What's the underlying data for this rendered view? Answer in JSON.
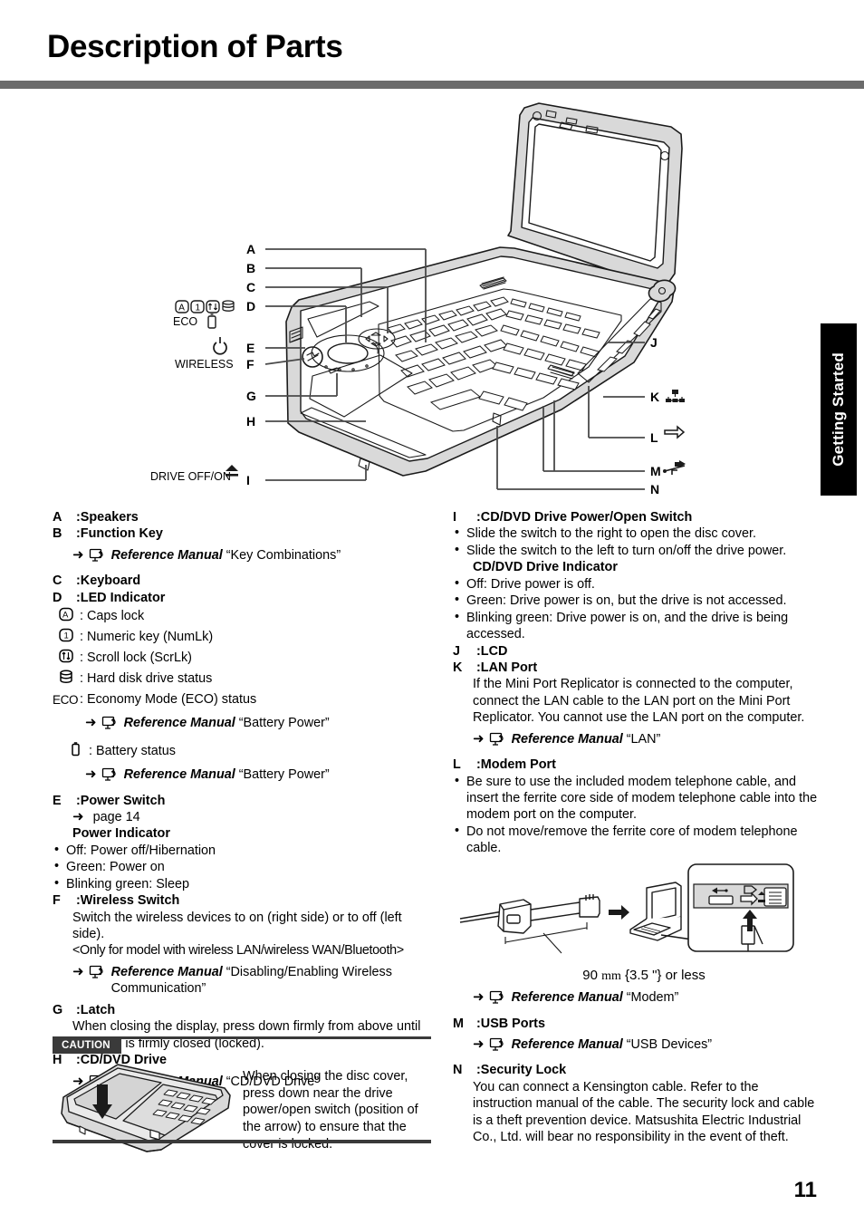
{
  "page": {
    "title": "Description of Parts",
    "number": "11",
    "side_tab": "Getting Started"
  },
  "figure": {
    "callouts_left": [
      "A",
      "B",
      "C",
      "D",
      "E",
      "F",
      "G",
      "H",
      "I"
    ],
    "callouts_right": [
      "J",
      "K",
      "L",
      "M",
      "N"
    ],
    "annotations": {
      "eco": "ECO",
      "wireless": "WIRELESS",
      "drive_off_on": "DRIVE OFF/ON"
    }
  },
  "left_column": {
    "A": {
      "letter": "A",
      "title": "Speakers"
    },
    "B": {
      "letter": "B",
      "title": "Function Key",
      "ref": {
        "manual": "Reference Manual",
        "topic": "“Key Combinations”"
      }
    },
    "C": {
      "letter": "C",
      "title": "Keyboard"
    },
    "D": {
      "letter": "D",
      "title": "LED Indicator",
      "items": [
        {
          "icon": "caps-lock-icon",
          "text": ": Caps lock"
        },
        {
          "icon": "numlock-icon",
          "text": ": Numeric key (NumLk)"
        },
        {
          "icon": "scroll-lock-icon",
          "text": ": Scroll lock (ScrLk)"
        },
        {
          "icon": "hard-disk-icon",
          "text": ": Hard disk drive status"
        },
        {
          "icon": "eco-text",
          "label": "ECO",
          "text": ": Economy Mode (ECO) status"
        }
      ],
      "eco_ref": {
        "manual": "Reference Manual",
        "topic": "“Battery Power”"
      },
      "battery": {
        "icon": "battery-icon",
        "text": ": Battery status"
      },
      "battery_ref": {
        "manual": "Reference Manual",
        "topic": "“Battery Power”"
      }
    },
    "E": {
      "letter": "E",
      "title": "Power Switch",
      "page_ref": "page 14",
      "subtitle": "Power Indicator",
      "bullets": [
        "Off: Power off/Hibernation",
        "Green: Power on",
        "Blinking green: Sleep"
      ]
    },
    "F": {
      "letter": "F",
      "title": "Wireless Switch",
      "body": "Switch the wireless devices to on (right side) or to off (left side).",
      "note": "<Only for model with wireless LAN/wireless WAN/Bluetooth>",
      "ref": {
        "manual": "Reference Manual",
        "topic": "“Disabling/Enabling Wireless Communication”"
      }
    },
    "G": {
      "letter": "G",
      "title": "Latch",
      "body": "When closing the display, press down firmly from above until the latch is firmly closed (locked)."
    },
    "H": {
      "letter": "H",
      "title": "CD/DVD Drive",
      "ref": {
        "manual": "Reference Manual",
        "topic": "“CD/DVD Drive”"
      }
    }
  },
  "right_column": {
    "I": {
      "letter": "I",
      "title": "CD/DVD Drive Power/Open Switch",
      "bullets": [
        "Slide the switch to the right to open the disc cover.",
        "Slide the switch to the left to turn on/off the drive power."
      ],
      "subtitle": "CD/DVD Drive Indicator",
      "bullets2": [
        "Off: Drive power is off.",
        "Green: Drive power is on, but the drive is not accessed.",
        "Blinking green: Drive power is on, and the drive is being accessed."
      ]
    },
    "J": {
      "letter": "J",
      "title": "LCD"
    },
    "K": {
      "letter": "K",
      "title": "LAN Port",
      "body": "If the Mini Port Replicator is connected to the computer, connect the LAN cable to the LAN port on the Mini Port Replicator. You cannot use the LAN port on the computer.",
      "ref": {
        "manual": "Reference Manual",
        "topic": "“LAN”"
      }
    },
    "L": {
      "letter": "L",
      "title": "Modem Port",
      "bullets": [
        "Be sure to use the included modem telephone cable, and insert the ferrite core side of modem telephone cable into the modem port on the computer.",
        "Do not move/remove the ferrite core of modem telephone cable."
      ],
      "figure_caption": "90 mm {3.5 \"} or less",
      "figure_caption_value": "90",
      "figure_caption_unit": "mm",
      "figure_caption_rest": "{3.5 \"} or less",
      "ref": {
        "manual": "Reference Manual",
        "topic": "“Modem”"
      }
    },
    "M": {
      "letter": "M",
      "title": "USB Ports",
      "ref": {
        "manual": "Reference Manual",
        "topic": "“USB Devices”"
      }
    },
    "N": {
      "letter": "N",
      "title": "Security Lock",
      "body": "You can connect a Kensington cable. Refer to the instruction manual of the cable. The security lock and cable is a theft prevention device. Matsushita Electric Industrial Co., Ltd. will bear no responsibility in the event of theft."
    }
  },
  "caution": {
    "label": "CAUTION",
    "text": "When closing the disc cover, press down near the drive power/open switch (position of the arrow) to ensure that the cover is locked."
  },
  "colors": {
    "rule": "#6b6b6b",
    "caution_bar": "#3a3a3a",
    "illustration_fill": "#d9d9d9",
    "illustration_line": "#1a1a1a"
  }
}
